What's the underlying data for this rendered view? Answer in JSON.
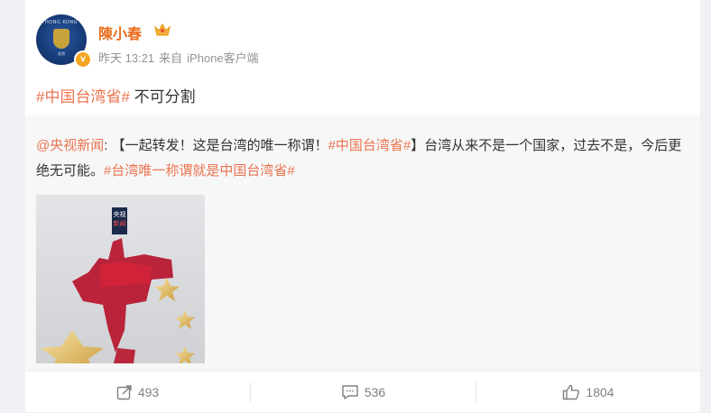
{
  "post": {
    "username": "陳小春",
    "time": "昨天 13:21",
    "source_prefix": "来自",
    "source": "iPhone客户端",
    "topic": "#中国台湾省#",
    "text": " 不可分割"
  },
  "avatar": {
    "top_text": "HONG KONG",
    "bottom_text": "香港"
  },
  "repost": {
    "user": "@央视新闻",
    "colon": ": ",
    "text_part1": "【一起转发！这是台湾的唯一称谓！",
    "topic1": "#中国台湾省#",
    "text_part2": "】台湾从来不是一个国家，过去不是，今后更绝无可能。",
    "topic2": "#台湾唯一称谓就是中国台湾省#",
    "image_label_line1": "央视",
    "image_label_line2": "新闻"
  },
  "actions": {
    "repost_count": "493",
    "comment_count": "536",
    "like_count": "1804"
  },
  "colors": {
    "accent": "#eb7350",
    "username": "#ea6c1b",
    "meta": "#939393"
  },
  "icons": [
    "crown-icon",
    "verified-icon",
    "repost-icon",
    "comment-icon",
    "like-icon"
  ]
}
